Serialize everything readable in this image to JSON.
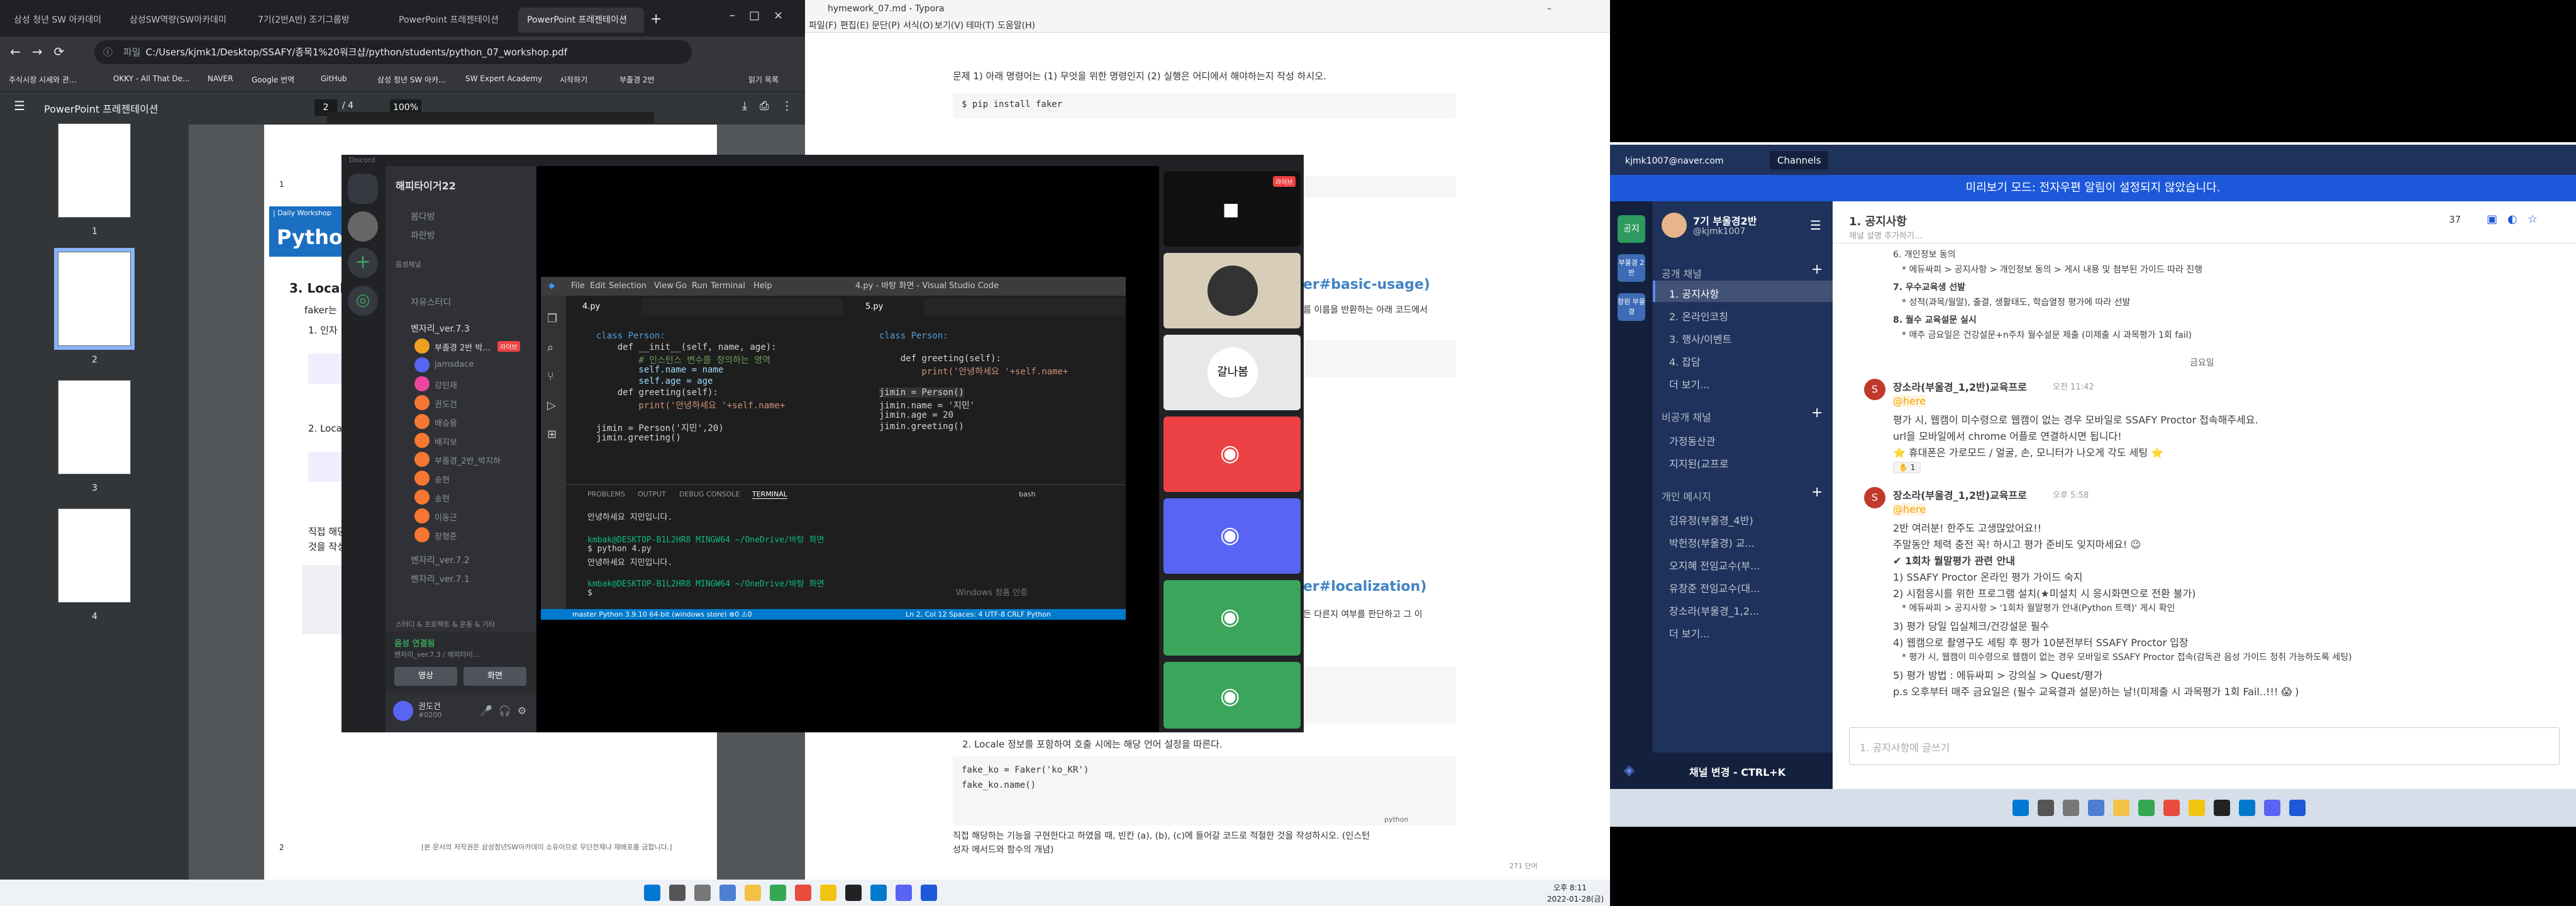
{
  "chrome": {
    "tabs": [
      "삼성 청년 SW 아카데미",
      "삼성SW역량(SW아카데미",
      "7기(2반A반) 조기그룹방",
      "PowerPoint 프레젠테이션",
      "PowerPoint 프레젠테이션"
    ],
    "url": "C:/Users/kjmk1/Desktop/SSAFY/종목1%20워크샵/python/students/python_07_workshop.pdf",
    "url_prefix": "파일",
    "bookmarks": [
      "주식시장 시세와 관...",
      "OKKY - All That De...",
      "NAVER",
      "Google 번역",
      "GitHub",
      "삼성 청년 SW 아카...",
      "SW Expert Academy",
      "시작하기",
      "부졸경 2반",
      "읽기 목록"
    ],
    "pdf_title": "PowerPoint 프레젠테이션",
    "page_current": "2",
    "page_total": "/ 4",
    "zoom": "100%",
    "thumb_numbers": [
      "1",
      "2",
      "3",
      "4"
    ],
    "page_label": "| Daily Workshop",
    "page_heading": "Pytho",
    "page_section": "3. Locali",
    "page_line1": "faker는",
    "page_line2": "1.  인자",
    "page_line3": "2.  Locale",
    "page_line4": "직접 해당",
    "page_line5": "것을 작성",
    "page_footer": "[본 문서의 저작권은 삼성청년SW아카데미 소유이므로 무단전재나 재배포를 금합니다.]",
    "page_num_a": "1",
    "page_num_b": "2"
  },
  "discord": {
    "app_label": "Discord",
    "server_name": "해피타이거22",
    "categories": [
      "봄다방",
      "파란방",
      "음성채널",
      "자유스터디"
    ],
    "voice_channel": "벤자리_ver.7.3",
    "members": [
      "부졸경 2반 박...",
      "jamsdace",
      "강민재",
      "권도건",
      "배승용",
      "배지보",
      "부졸경_2반_박지하",
      "송현",
      "송현",
      "이동근",
      "장형준"
    ],
    "live_badge": "라이브",
    "other_channels": [
      "벤자리_ver.7.2",
      "벤자리_ver.7.1"
    ],
    "thread_label": "스터디 & 프로젝트 & 운동 & 기타",
    "status_title": "음성 연결됨",
    "status_sub": "벤자리_ver.7.3 / 해피타이...",
    "video_btn": "영상",
    "screen_btn": "화면",
    "user_name": "권도건",
    "user_tag": "#0200",
    "tile_text": "갈나봄",
    "stream_live": "라이브"
  },
  "vscode": {
    "menu": [
      "File",
      "Edit",
      "Selection",
      "View",
      "Go",
      "Run",
      "Terminal",
      "Help"
    ],
    "title": "4.py - 바탕 화면 - Visual Studio Code",
    "tab_left": "4.py",
    "tab_right": "5.py",
    "code_left": [
      "class Person:",
      "    def __init__(self, name, age):",
      "        # 인스턴스 변수를 정의하는 영역",
      "        self.name = name",
      "        self.age = age",
      "    def greeting(self):",
      "        print('안녕하세요 '+self.name+",
      "",
      "jimin = Person('지민',20)",
      "jimin.greeting()"
    ],
    "code_right": [
      "class Person:",
      "",
      "    def greeting(self):",
      "        print('안녕하세요 '+self.name+",
      "",
      "jimin = Person()",
      "jimin.name = '지민'",
      "jimin.age = 20",
      "jimin.greeting()"
    ],
    "panel_tabs": [
      "PROBLEMS",
      "OUTPUT",
      "DEBUG CONSOLE",
      "TERMINAL"
    ],
    "terminal_lines": [
      "안녕하세요 지민입니다.",
      "kmbak@DESKTOP-B1L2HR8 MINGW64 ~/OneDrive/바탕 화면",
      "$ python 4.py",
      "안녕하세요 지민입니다.",
      "kmbak@DESKTOP-B1L2HR8 MINGW64 ~/OneDrive/바탕 화면",
      "$ "
    ],
    "shell": "bash",
    "status": "master    Python 3.9.10 64-bit (windows store)    ⊗0 ⚠0",
    "status_right": "Ln 2, Col 12   Spaces: 4   UTF-8   CRLF   Python",
    "win_activate": "Windows 정품 인증"
  },
  "typora": {
    "title": "hymework_07.md - Typora",
    "menu": [
      "파일(F)",
      "편집(E)",
      "문단(P)",
      "서식(O)",
      "보기(V)",
      "테마(T)",
      "도움말(H)"
    ],
    "q1": "문제 1)  아래 명령어는 (1) 무엇을 위한 명령인지 (2) 실행은 어디에서 해야하는지 작성 하시오.",
    "q1_code": "$ pip install faker",
    "link1": "er#basic-usage)",
    "frag1": "름 이름을 반환하는 아래 코드에서",
    "link2": "er#localization)",
    "frag2": "든 다른지 여부를 판단하고 그 이",
    "locale_text": "2. Locale 정보를 포함하여 호출 시에는 해당 언어 설정을 따른다.",
    "code2": [
      "fake_ko = Faker('ko_KR')",
      "fake_ko.name()"
    ],
    "code_lang": "python",
    "bottom_text": "직접 해당하는 기능을 구현한다고 하였을 때, 빈칸 (a), (b), (c)에 들어갈 코드로 적절한 것을 작성하시오. (인스턴",
    "bottom_text2": "성자 메서드와 함수의 개념)",
    "status_words": "271 단어"
  },
  "mattermost": {
    "email": "kjmk1007@naver.com",
    "channels_tab": "Channels",
    "banner": "미리보기 모드: 전자우편 알림이 설정되지 않았습니다.",
    "team_name": "7기 부울경2반",
    "username": "@kjmk1007",
    "team_badges": [
      "공지",
      "부울경 2반",
      "창원 부울경"
    ],
    "public_header": "공개 채널",
    "public_channels": [
      "1. 공지사항",
      "2. 온라인코칭",
      "3. 행사/이벤트",
      "4. 잡담"
    ],
    "more": "더 보기...",
    "private_header": "비공개 채널",
    "private_channels": [
      "가정동산관",
      "지지된(교프로"
    ],
    "dm_header": "개인 메시지",
    "dms": [
      "김유정(부울경_4반)",
      "박헌정(부울경) 교...",
      "오지혜 전임교수(부...",
      "유창준 전임교수(대...",
      "장소라(부울경_1,2..."
    ],
    "dm_more": "더 보기...",
    "switch_channel": "채널 변경 - CTRL+K",
    "channel_title": "1. 공지사항",
    "channel_sub": "채널 설명 추가하기...",
    "member_count": "37",
    "list_prev": [
      "6. 개인정보 동의",
      "* 에듀싸피 > 공지사항 > 개인정보 동의 > 게시 내용 및 첨부된 가이드 따라 진행",
      "7. 우수교육생 선발",
      "* 성적(과목/월말), 출결, 생활태도, 학습열정 평가에 따라 선발",
      "8. 월수 교육설문 실시",
      "* 매주 금요일은 건강설문+n주차 월수설문 제출 (미제출 시 과목평가 1회 fail)"
    ],
    "date_sep": "금요일",
    "msg1_author": "장소라(부울경_1,2반)교육프로",
    "msg1_time": "오전 11:42",
    "msg1_lines": [
      "@here",
      "평가 시, 웹캠이 미수령으로 웹캠이 없는 경우 모바일로 SSAFY Proctor 접속해주세요.",
      "url을 모바일에서 chrome 어플로 연결하시면 됩니다!",
      "⭐ 휴대폰은 가로모드 / 얼굴, 손, 모니터가 나오게 각도 세팅 ⭐"
    ],
    "msg1_reaction": "1",
    "msg2_author": "장소라(부울경_1,2반)교육프로",
    "msg2_time": "오후 5:58",
    "msg2_lines": [
      "@here",
      "2반 여러분! 한주도 고생많았어요!!",
      "주말동안 체력 충전 꼭! 하시고 평가 준비도 잊지마세요! 😉",
      "✔ 1회차 월말평가 관련 안내",
      "1) SSAFY Proctor 온라인 평가 가이드 숙지",
      "2) 시험응시를 위한 프로그램 설치(★미설치 시 응시화면으로 전환 불가)",
      "* 에듀싸피 > 공지사항 > '1회차 월말평가 안내(Python 트랙)' 게시 확인",
      "3) 평가 당일 입실체크/건강설문 필수",
      "4) 웹캠으로 촬영구도 세팅 후 평가 10분전부터 SSAFY Proctor 입장",
      "* 평가 시, 웹캠이 미수령으로 웹캠이 없는 경우 모바일로 SSAFY Proctor 접속(감독관 음성 가이드 청취 가능하도록 세팅)",
      "5) 평가 방법 : 에듀싸피 > 강의실 > Quest/평가",
      "p.s 오후부터 매주 금요일은 (필수 교육결과 설문)하는 날!(미제출 시 과목평가 1회 Fail..!!! 😱 )"
    ],
    "input_placeholder": "1. 공지사항에 글쓰기"
  },
  "taskbar": {
    "time": "오후 8:11",
    "date": "2022-01-28(금)"
  },
  "colors": {
    "discord_red": "#ed4245",
    "discord_blurple": "#5865f2",
    "discord_green": "#3ba55c",
    "mm_sidebar": "#1e325c",
    "mm_banner": "#1c58d9",
    "vscode_blue": "#007acc"
  }
}
